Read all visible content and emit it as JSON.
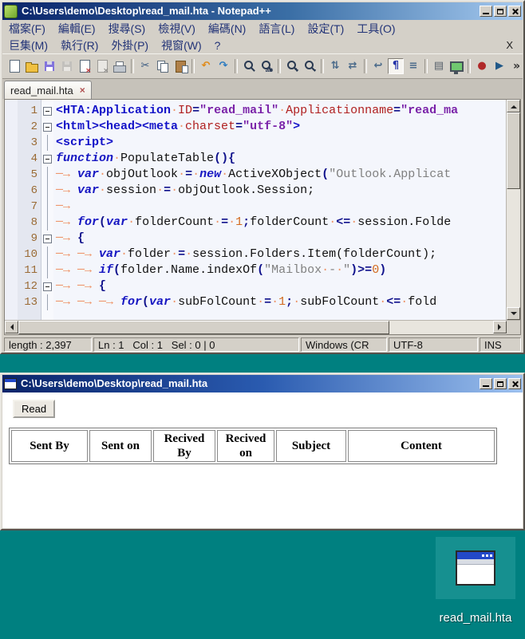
{
  "colors": {
    "desktop_bg": "#008080",
    "titlebar_gradient_start": "#0a246a",
    "titlebar_gradient_end": "#a6caf0",
    "window_face": "#d4d0c8",
    "editor_bg": "#f4f6fc"
  },
  "desktop": {
    "icon_label": "read_mail.hta"
  },
  "notepad": {
    "title": "C:\\Users\\demo\\Desktop\\read_mail.hta - Notepad++",
    "menu": {
      "row1": [
        "檔案(F)",
        "編輯(E)",
        "搜尋(S)",
        "檢視(V)",
        "編碼(N)",
        "語言(L)",
        "設定(T)",
        "工具(O)"
      ],
      "row2": [
        "巨集(M)",
        "執行(R)",
        "外掛(P)",
        "視窗(W)",
        "?"
      ],
      "close_x": "X"
    },
    "toolbar": [
      {
        "name": "new-file-icon",
        "kind": "page"
      },
      {
        "name": "open-file-icon",
        "kind": "folder"
      },
      {
        "name": "save-icon",
        "kind": "floppy",
        "bg": "#8274dc"
      },
      {
        "name": "save-all-icon",
        "kind": "floppy",
        "bg": "#b6b2aa",
        "disabled": true
      },
      {
        "name": "close-file-icon",
        "kind": "pagex"
      },
      {
        "name": "close-all-icon",
        "kind": "pagex",
        "disabled": true
      },
      {
        "name": "print-icon",
        "kind": "printer"
      },
      {
        "sep": true
      },
      {
        "name": "cut-icon",
        "kind": "glyph",
        "glyph": "✂",
        "fg": "#3a5a80"
      },
      {
        "name": "copy-icon",
        "kind": "copy"
      },
      {
        "name": "paste-icon",
        "kind": "paste"
      },
      {
        "sep": true
      },
      {
        "name": "undo-icon",
        "kind": "glyph",
        "glyph": "↶",
        "fg": "#e08a18"
      },
      {
        "name": "redo-icon",
        "kind": "glyph",
        "glyph": "↷",
        "fg": "#2a7ac0"
      },
      {
        "sep": true
      },
      {
        "name": "find-icon",
        "kind": "mag"
      },
      {
        "name": "replace-icon",
        "kind": "mag",
        "sub": "ab"
      },
      {
        "sep": true
      },
      {
        "name": "zoom-in-icon",
        "kind": "mag",
        "sub": "+"
      },
      {
        "name": "zoom-out-icon",
        "kind": "mag",
        "sub": "−"
      },
      {
        "sep": true
      },
      {
        "name": "sync-vertical-scroll-icon",
        "kind": "glyph",
        "glyph": "⇅",
        "fg": "#4a6a8a"
      },
      {
        "name": "sync-horizontal-scroll-icon",
        "kind": "glyph",
        "glyph": "⇄",
        "fg": "#4a6a8a"
      },
      {
        "sep": true
      },
      {
        "name": "word-wrap-icon",
        "kind": "glyph",
        "glyph": "↩",
        "fg": "#4a6a8a"
      },
      {
        "name": "show-all-characters-icon",
        "kind": "glyph",
        "glyph": "¶",
        "fg": "#2634a8",
        "pressed": true
      },
      {
        "name": "indent-guide-icon",
        "kind": "glyph",
        "glyph": "≡",
        "fg": "#4a6a8a"
      },
      {
        "sep": true
      },
      {
        "name": "document-map-icon",
        "kind": "glyph",
        "glyph": "▤",
        "fg": "#56606a"
      },
      {
        "name": "document-monitor-icon",
        "kind": "monitor"
      },
      {
        "sep": true
      },
      {
        "name": "record-macro-icon",
        "kind": "glyph",
        "glyph": "●",
        "fg": "#b02828"
      },
      {
        "name": "play-macro-icon",
        "kind": "glyph",
        "glyph": "▶",
        "fg": "#205888"
      }
    ],
    "toolbar_overflow": "»",
    "tab": {
      "label": "read_mail.hta",
      "close_glyph": "×"
    },
    "code_lines": [
      {
        "num": "1",
        "fold": "box",
        "segs": [
          {
            "c": "tag",
            "t": "<HTA:Application"
          },
          {
            "c": "ws",
            "t": "·"
          },
          {
            "c": "attr",
            "t": "ID"
          },
          {
            "c": "op",
            "t": "="
          },
          {
            "c": "val",
            "t": "\"read_mail\""
          },
          {
            "c": "ws",
            "t": "·"
          },
          {
            "c": "attr",
            "t": "Applicationname"
          },
          {
            "c": "op",
            "t": "="
          },
          {
            "c": "val",
            "t": "\"read_ma"
          }
        ]
      },
      {
        "num": "2",
        "fold": "box",
        "segs": [
          {
            "c": "tag",
            "t": "<html><head><meta"
          },
          {
            "c": "ws",
            "t": "·"
          },
          {
            "c": "attr",
            "t": "charset"
          },
          {
            "c": "op",
            "t": "="
          },
          {
            "c": "val",
            "t": "\"utf-8\""
          },
          {
            "c": "tag",
            "t": ">"
          }
        ]
      },
      {
        "num": "3",
        "fold": "line",
        "segs": [
          {
            "c": "tag",
            "t": "<script>"
          }
        ]
      },
      {
        "num": "4",
        "fold": "box",
        "segs": [
          {
            "c": "kw",
            "t": "function"
          },
          {
            "c": "ws",
            "t": "·"
          },
          {
            "c": "plain",
            "t": "PopulateTable"
          },
          {
            "c": "op",
            "t": "(){"
          }
        ]
      },
      {
        "num": "5",
        "fold": "line",
        "segs": [
          {
            "c": "ws",
            "t": "→"
          },
          {
            "c": "kw",
            "t": "var"
          },
          {
            "c": "ws",
            "t": "·"
          },
          {
            "c": "plain",
            "t": "objOutlook"
          },
          {
            "c": "ws",
            "t": "·"
          },
          {
            "c": "op",
            "t": "="
          },
          {
            "c": "ws",
            "t": "·"
          },
          {
            "c": "kw",
            "t": "new"
          },
          {
            "c": "ws",
            "t": "·"
          },
          {
            "c": "plain",
            "t": "ActiveXObject"
          },
          {
            "c": "op",
            "t": "("
          },
          {
            "c": "str",
            "t": "\"Outlook.Applicat"
          }
        ]
      },
      {
        "num": "6",
        "fold": "line",
        "segs": [
          {
            "c": "ws",
            "t": "→"
          },
          {
            "c": "kw",
            "t": "var"
          },
          {
            "c": "ws",
            "t": "·"
          },
          {
            "c": "plain",
            "t": "session"
          },
          {
            "c": "ws",
            "t": "·"
          },
          {
            "c": "op",
            "t": "="
          },
          {
            "c": "ws",
            "t": "·"
          },
          {
            "c": "plain",
            "t": "objOutlook.Session;"
          }
        ]
      },
      {
        "num": "7",
        "fold": "line",
        "segs": [
          {
            "c": "ws",
            "t": "→"
          }
        ]
      },
      {
        "num": "8",
        "fold": "line",
        "segs": [
          {
            "c": "ws",
            "t": "→"
          },
          {
            "c": "kw",
            "t": "for"
          },
          {
            "c": "op",
            "t": "("
          },
          {
            "c": "kw",
            "t": "var"
          },
          {
            "c": "ws",
            "t": "·"
          },
          {
            "c": "plain",
            "t": "folderCount"
          },
          {
            "c": "ws",
            "t": "·"
          },
          {
            "c": "op",
            "t": "="
          },
          {
            "c": "ws",
            "t": "·"
          },
          {
            "c": "num",
            "t": "1"
          },
          {
            "c": "op",
            "t": ";"
          },
          {
            "c": "plain",
            "t": "folderCount"
          },
          {
            "c": "ws",
            "t": "·"
          },
          {
            "c": "op",
            "t": "<="
          },
          {
            "c": "ws",
            "t": "·"
          },
          {
            "c": "plain",
            "t": "session.Folde"
          }
        ]
      },
      {
        "num": "9",
        "fold": "box",
        "segs": [
          {
            "c": "ws",
            "t": "→"
          },
          {
            "c": "op",
            "t": "{"
          }
        ]
      },
      {
        "num": "10",
        "fold": "line",
        "segs": [
          {
            "c": "ws",
            "t": "→→"
          },
          {
            "c": "kw",
            "t": "var"
          },
          {
            "c": "ws",
            "t": "·"
          },
          {
            "c": "plain",
            "t": "folder"
          },
          {
            "c": "ws",
            "t": "·"
          },
          {
            "c": "op",
            "t": "="
          },
          {
            "c": "ws",
            "t": "·"
          },
          {
            "c": "plain",
            "t": "session.Folders.Item(folderCount);"
          }
        ]
      },
      {
        "num": "11",
        "fold": "line",
        "segs": [
          {
            "c": "ws",
            "t": "→→"
          },
          {
            "c": "kw",
            "t": "if"
          },
          {
            "c": "op",
            "t": "("
          },
          {
            "c": "plain",
            "t": "folder.Name.indexOf"
          },
          {
            "c": "op",
            "t": "("
          },
          {
            "c": "str",
            "t": "\"Mailbox"
          },
          {
            "c": "ws",
            "t": "·"
          },
          {
            "c": "str",
            "t": "-"
          },
          {
            "c": "ws",
            "t": "·"
          },
          {
            "c": "str",
            "t": "\""
          },
          {
            "c": "op",
            "t": ")>="
          },
          {
            "c": "num",
            "t": "0"
          },
          {
            "c": "op",
            "t": ")"
          }
        ]
      },
      {
        "num": "12",
        "fold": "box",
        "segs": [
          {
            "c": "ws",
            "t": "→→"
          },
          {
            "c": "op",
            "t": "{"
          }
        ]
      },
      {
        "num": "13",
        "fold": "line",
        "segs": [
          {
            "c": "ws",
            "t": "→→→"
          },
          {
            "c": "kw",
            "t": "for"
          },
          {
            "c": "op",
            "t": "("
          },
          {
            "c": "kw",
            "t": "var"
          },
          {
            "c": "ws",
            "t": "·"
          },
          {
            "c": "plain",
            "t": "subFolCount"
          },
          {
            "c": "ws",
            "t": "·"
          },
          {
            "c": "op",
            "t": "="
          },
          {
            "c": "ws",
            "t": "·"
          },
          {
            "c": "num",
            "t": "1"
          },
          {
            "c": "op",
            "t": ";"
          },
          {
            "c": "ws",
            "t": "·"
          },
          {
            "c": "plain",
            "t": "subFolCount"
          },
          {
            "c": "ws",
            "t": "·"
          },
          {
            "c": "op",
            "t": "<="
          },
          {
            "c": "ws",
            "t": "·"
          },
          {
            "c": "plain",
            "t": "fold"
          }
        ]
      }
    ],
    "status": {
      "length": "length : 2,397",
      "position": "Ln : 1   Col : 1   Sel : 0 | 0",
      "eol": "Windows (CR",
      "encoding": "UTF-8",
      "mode": "INS"
    }
  },
  "hta": {
    "title": "C:\\Users\\demo\\Desktop\\read_mail.hta",
    "read_button": "Read",
    "table_headers": [
      "Sent By",
      "Sent on",
      "Recived By",
      "Recived on",
      "Subject",
      "Content"
    ]
  }
}
